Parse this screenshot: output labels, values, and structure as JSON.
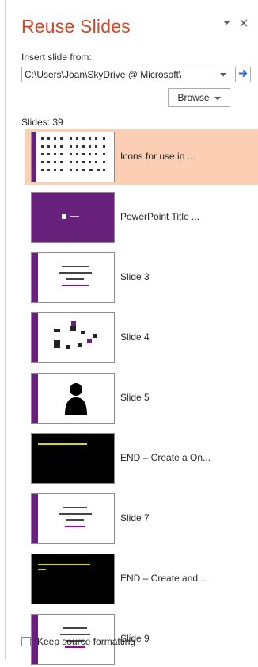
{
  "pane": {
    "title": "Reuse Slides",
    "options_icon": "chevron-down-icon",
    "close_icon": "close-icon"
  },
  "insert": {
    "label": "Insert slide from:",
    "path_value": "C:\\Users\\Joan\\SkyDrive @ Microsoft\\",
    "go_icon": "arrow-right-icon",
    "browse_label": "Browse"
  },
  "slides": {
    "count_label": "Slides: 39",
    "items": [
      {
        "name": "Icons for use in ...",
        "selected": true
      },
      {
        "name": "PowerPoint Title ...",
        "selected": false
      },
      {
        "name": "Slide 3",
        "selected": false
      },
      {
        "name": "Slide 4",
        "selected": false
      },
      {
        "name": "Slide 5",
        "selected": false
      },
      {
        "name": "END – Create a On...",
        "selected": false
      },
      {
        "name": "Slide 7",
        "selected": false
      },
      {
        "name": "END – Create and ...",
        "selected": false
      },
      {
        "name": "Slide 9",
        "selected": false
      }
    ]
  },
  "footer": {
    "keep_source_label": "Keep source formatting",
    "keep_source_checked": false
  },
  "colors": {
    "accent": "#d24726",
    "selected_bg": "#fcceb3",
    "purple": "#68217a",
    "link_blue": "#1e6fc4"
  }
}
